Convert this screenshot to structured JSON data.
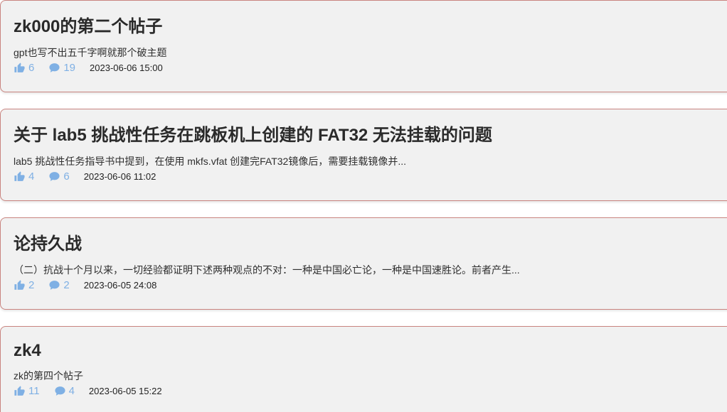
{
  "theme": {
    "card_background": "#f1f1f1",
    "card_border": "#c9847f",
    "accent_icon_color": "#7fb0e4"
  },
  "posts": [
    {
      "title": "zk000的第二个帖子",
      "excerpt": "gpt也写不出五千字啊就那个破主题",
      "likes": "6",
      "comments": "19",
      "time": "2023-06-06 15:00"
    },
    {
      "title": "关于 lab5 挑战性任务在跳板机上创建的 FAT32 无法挂载的问题",
      "excerpt": "lab5 挑战性任务指导书中提到，在使用 mkfs.vfat 创建完FAT32镜像后，需要挂载镜像并...",
      "likes": "4",
      "comments": "6",
      "time": "2023-06-06 11:02"
    },
    {
      "title": "论持久战",
      "excerpt": "（二）抗战十个月以来，一切经验都证明下述两种观点的不对：一种是中国必亡论，一种是中国速胜论。前者产生...",
      "likes": "2",
      "comments": "2",
      "time": "2023-06-05 24:08"
    },
    {
      "title": "zk4",
      "excerpt": "zk的第四个帖子",
      "likes": "11",
      "comments": "4",
      "time": "2023-06-05 15:22"
    }
  ],
  "icons": {
    "like": "thumbs-up-icon",
    "comment": "comment-bubble-icon"
  }
}
